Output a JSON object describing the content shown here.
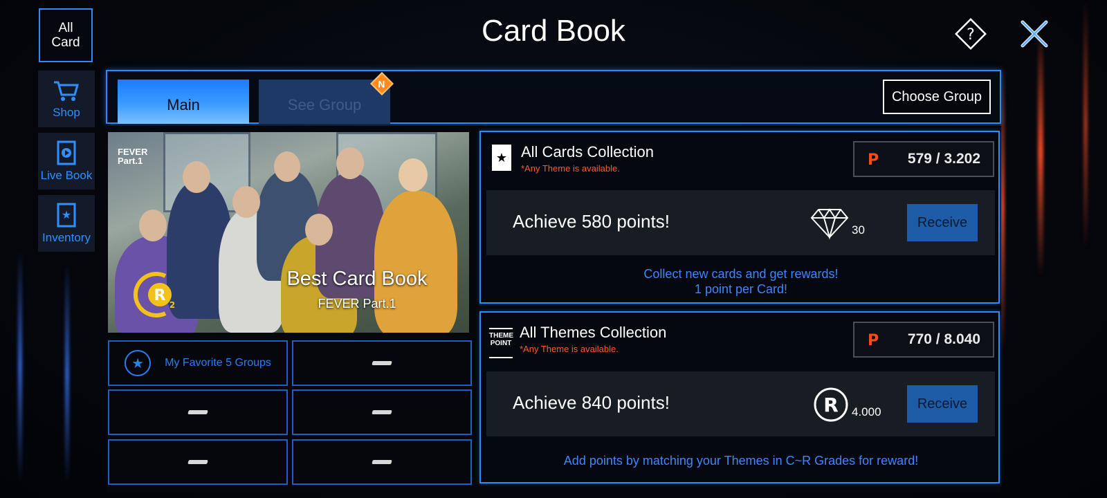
{
  "title": "Card Book",
  "nav": {
    "all_card": "All\nCard",
    "items": [
      {
        "label": "Shop",
        "icon": "cart-icon"
      },
      {
        "label": "Live Book",
        "icon": "play-book-icon"
      },
      {
        "label": "Inventory",
        "icon": "star-card-icon"
      }
    ]
  },
  "tabs": {
    "main": "Main",
    "see_group": "See Group",
    "new_badge": "N"
  },
  "choose_group": "Choose Group",
  "hero": {
    "logo_line1": "FEVER",
    "logo_line2": "Part.1",
    "title": "Best Card Book",
    "subtitle": "FEVER Part.1",
    "rank": "R",
    "rank_sub": "2"
  },
  "favorites": {
    "label": "My Favorite 5 Groups",
    "empty_slot": "—"
  },
  "all_cards": {
    "title": "All Cards Collection",
    "note": "*Any Theme is available.",
    "points": "579 / 3.202",
    "goal": "Achieve 580 points!",
    "reward_icon": "diamond-icon",
    "reward_amount": "30",
    "receive": "Receive",
    "info_line1": "Collect new cards and get rewards!",
    "info_line2": "1 point per Card!"
  },
  "all_themes": {
    "badge_line1": "THEME",
    "badge_line2": "POINT",
    "title": "All Themes Collection",
    "note": "*Any Theme is available.",
    "points": "770 / 8.040",
    "goal": "Achieve 840 points!",
    "reward_icon": "r-coin-icon",
    "reward_amount": "4.000",
    "receive": "Receive",
    "info": "Add points by matching your Themes in C~R Grades for reward!"
  },
  "colors": {
    "accent_blue": "#2a8cff",
    "note_orange": "#ff5a2a",
    "point_icon": "#ff4a1a",
    "receive_btn": "#1f5ca8"
  }
}
